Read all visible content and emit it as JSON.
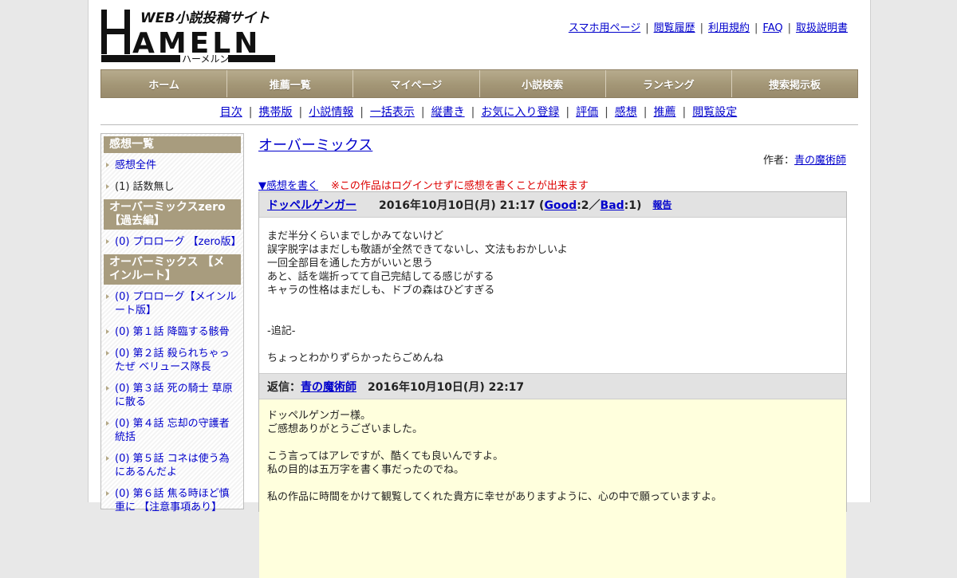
{
  "logo": {
    "tagline": "WEB小説投稿サイト",
    "name": "HAMELN",
    "kana": "ハーメルン"
  },
  "header_links": [
    "スマホ用ページ",
    "閲覧履歴",
    "利用規約",
    "FAQ",
    "取扱説明書"
  ],
  "nav": [
    "ホーム",
    "推薦一覧",
    "マイページ",
    "小説検索",
    "ランキング",
    "捜索掲示板"
  ],
  "subnav": [
    "目次",
    "携帯版",
    "小説情報",
    "一括表示",
    "縦書き",
    "お気に入り登録",
    "評価",
    "感想",
    "推薦",
    "閲覧設定"
  ],
  "sidebar": {
    "heading1": "感想一覧",
    "link_all": "感想全件",
    "no_story": "(1) 話数無し",
    "heading2": "オーバーミックスzero【過去編】",
    "zero_items": [
      "(0) プロローグ 【zero版】"
    ],
    "heading3": "オーバーミックス 【メインルート】",
    "main_items": [
      "(0) プロローグ【メインルート版】",
      "(0) 第１話 降臨する骸骨",
      "(0) 第２話 殺られちゃったぜ ベリュース隊長",
      "(0) 第３話 死の騎士 草原に散る",
      "(0) 第４話 忘却の守護者統括",
      "(0) 第５話 コネは使う為にあるんだよ",
      "(0) 第６話 焦る時ほど慎重に 【注意事項あり】"
    ]
  },
  "main": {
    "title": "オーバーミックス",
    "author_label": "作者：",
    "author_name": "青の魔術師",
    "write_link": "▼感想を書く",
    "warning": "※この作品はログインせずに感想を書くことが出来ます"
  },
  "comment": {
    "user": "ドッペルゲンガー",
    "date": "2016年10月10日(月) 21:17 (",
    "good": "Good",
    "good_count": ":2／",
    "bad": "Bad",
    "bad_count": ":1)",
    "report": "報告",
    "lines": [
      "まだ半分くらいまでしかみてないけど",
      "誤字脱字はまだしも敬語が全然できてないし、文法もおかしいよ",
      "一回全部目を通した方がいいと思う",
      "あと、話を端折ってて自己完結してる感じがする",
      "キャラの性格はまだしも、ドブの森はひどすぎる",
      "",
      "",
      "-追記-",
      "",
      "ちょっとわかりずらかったらごめんね"
    ]
  },
  "reply": {
    "label": "返信：",
    "author": "青の魔術師",
    "date": "2016年10月10日(月) 22:17",
    "lines": [
      "ドッペルゲンガー様。",
      "ご感想ありがとうございました。",
      "",
      "こう言ってはアレですが、酷くても良いんですよ。",
      "私の目的は五万字を書く事だったのでね。",
      "",
      "私の作品に時間をかけて観覧してくれた貴方に幸せがありますように、心の中で願っていますよ。"
    ]
  }
}
